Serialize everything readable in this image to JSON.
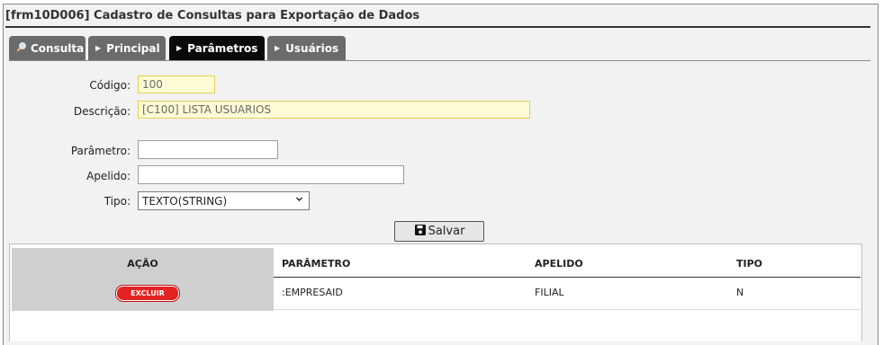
{
  "window": {
    "title": "[frm10D006] Cadastro de Consultas para Exportação de Dados"
  },
  "tabs": [
    {
      "label": "Consulta",
      "icon": "magnifier-icon",
      "active": false
    },
    {
      "label": "Principal",
      "icon": "triangle-right-icon",
      "active": false
    },
    {
      "label": "Parâmetros",
      "icon": "triangle-right-icon",
      "active": true
    },
    {
      "label": "Usuários",
      "icon": "triangle-right-icon",
      "active": false
    }
  ],
  "form": {
    "codigo": {
      "label": "Código:",
      "value": "100"
    },
    "descricao": {
      "label": "Descrição:",
      "value": "[C100] LISTA USUARIOS"
    },
    "parametro": {
      "label": "Parâmetro:",
      "value": ""
    },
    "apelido": {
      "label": "Apelido:",
      "value": ""
    },
    "tipo": {
      "label": "Tipo:",
      "value": "TEXTO(STRING)"
    }
  },
  "actions": {
    "save_label": "Salvar",
    "save_icon": "floppy-disk-icon"
  },
  "table": {
    "columns": [
      "AÇÃO",
      "PARÂMETRO",
      "APELIDO",
      "TIPO"
    ],
    "rows": [
      {
        "acao": "EXCLUIR",
        "parametro": ":EMPRESAID",
        "apelido": "FILIAL",
        "tipo": "N"
      }
    ]
  },
  "colors": {
    "active_tab": "#0a0a0a",
    "inactive_tab": "#6b6b6b",
    "readonly_bg": "#fffbd6",
    "readonly_border": "#e7cf4c",
    "delete_button": "#e32222"
  }
}
